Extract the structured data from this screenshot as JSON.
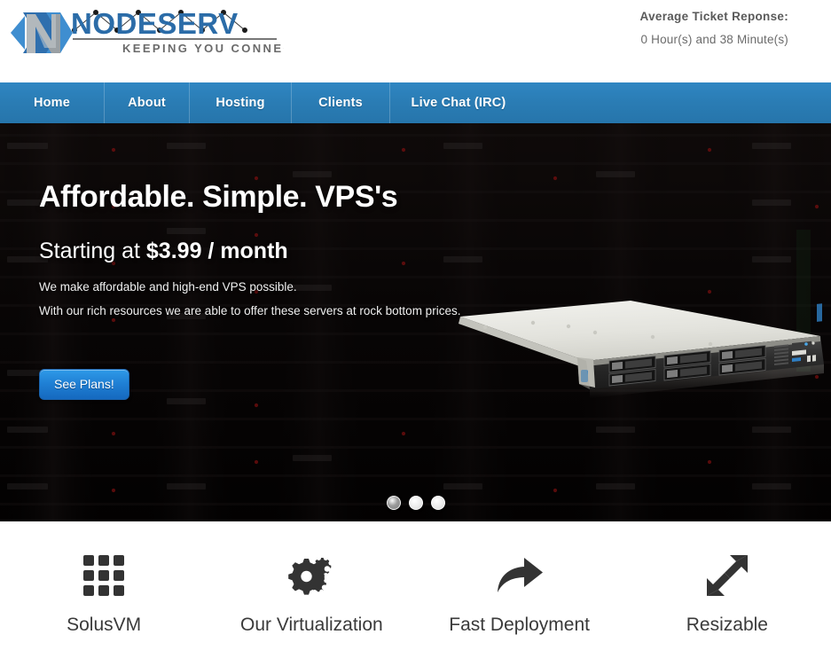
{
  "header": {
    "logo": {
      "mark_name": "nodeserv-logo-mark",
      "wordmark": "NODESERV",
      "tagline": "KEEPING YOU CONNECTED"
    },
    "ticket": {
      "title": "Average Ticket Reponse:",
      "value": "0 Hour(s) and 38 Minute(s)"
    }
  },
  "nav": {
    "items": [
      {
        "label": "Home"
      },
      {
        "label": "About"
      },
      {
        "label": "Hosting"
      },
      {
        "label": "Clients"
      },
      {
        "label": "Live Chat (IRC)"
      }
    ],
    "background_color": "#2a7cb4"
  },
  "hero": {
    "heading": "Affordable. Simple. VPS's",
    "subheading_prefix": "Starting at ",
    "subheading_price": "$3.99 / month",
    "paragraph_1": "We make affordable and high-end VPS possible.",
    "paragraph_2": "With our rich resources we are able to offer these servers at rock bottom prices.",
    "cta_label": "See Plans!",
    "cta_color": "#1f7fd4",
    "image_name": "rack-server-photo",
    "background_name": "datacenter-rack-background",
    "carousel": {
      "slide_count": 3,
      "active_index": 0
    }
  },
  "features": [
    {
      "label": "SolusVM",
      "icon": "grid-icon"
    },
    {
      "label": "Our Virtualization",
      "icon": "gears-icon"
    },
    {
      "label": "Fast Deployment",
      "icon": "curved-arrow-right-icon"
    },
    {
      "label": "Resizable",
      "icon": "expand-diagonal-arrows-icon"
    }
  ]
}
